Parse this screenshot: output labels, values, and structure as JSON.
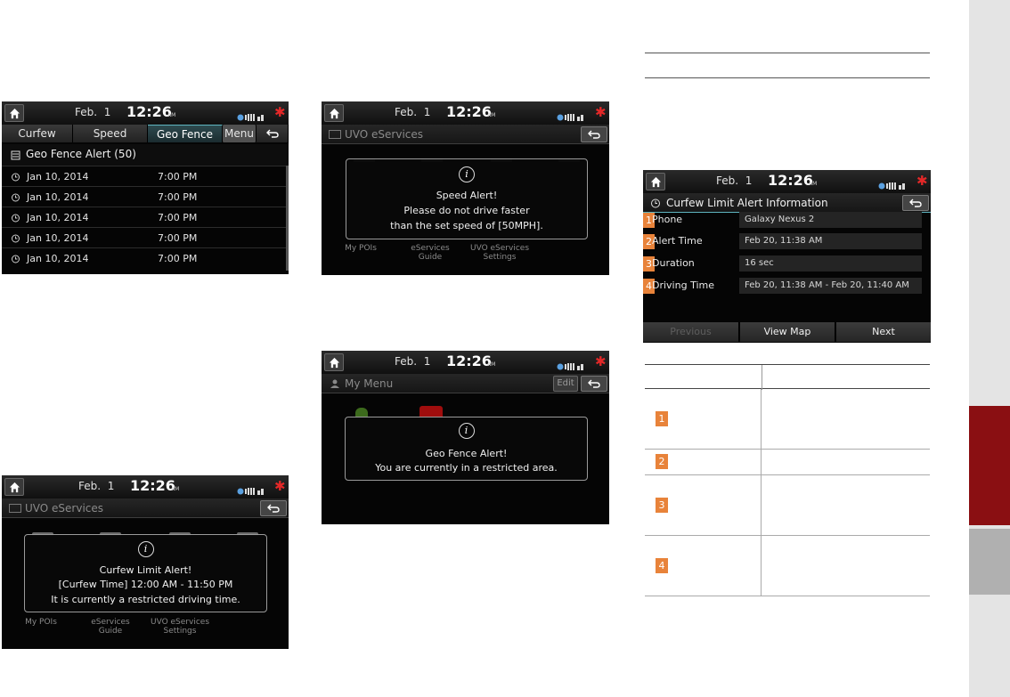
{
  "status": {
    "date": "Feb.  1",
    "time": "12:26",
    "ampm": "AM"
  },
  "screen_geofence_list": {
    "tabs": [
      "Curfew",
      "Speed",
      "Geo Fence",
      "Menu"
    ],
    "active_tab": "Geo Fence",
    "list_title": "Geo Fence Alert (50)",
    "rows": [
      {
        "date": "Jan 10, 2014",
        "time": "7:00 PM"
      },
      {
        "date": "Jan 10, 2014",
        "time": "7:00 PM"
      },
      {
        "date": "Jan 10, 2014",
        "time": "7:00 PM"
      },
      {
        "date": "Jan 10, 2014",
        "time": "7:00 PM"
      },
      {
        "date": "Jan 10, 2014",
        "time": "7:00 PM"
      }
    ]
  },
  "screen_speed_alert": {
    "title": "UVO eServices",
    "popup": {
      "heading": "Speed Alert!",
      "line1": "Please do not drive faster",
      "line2": "than the set speed of [50MPH]."
    },
    "bg_labels": [
      "My POIs",
      "eServices\nGuide",
      "UVO eServices\nSettings"
    ]
  },
  "screen_geofence_alert": {
    "title": "My Menu",
    "edit_label": "Edit",
    "popup": {
      "heading": "Geo Fence Alert!",
      "line1": "You are currently in a restricted area."
    }
  },
  "screen_curfew_alert": {
    "title": "UVO eServices",
    "popup": {
      "heading": "Curfew Limit Alert!",
      "line1": "[Curfew Time] 12:00 AM - 11:50 PM",
      "line2": "It is currently a restricted driving time."
    },
    "bg_labels": [
      "My POIs",
      "eServices\nGuide",
      "UVO eServices\nSettings"
    ]
  },
  "screen_curfew_info": {
    "title": "Curfew Limit Alert Information",
    "rows": [
      {
        "num": "1",
        "label": "Phone",
        "value": "Galaxy Nexus 2"
      },
      {
        "num": "2",
        "label": "Alert Time",
        "value": "Feb 20, 11:38 AM"
      },
      {
        "num": "3",
        "label": "Duration",
        "value": "16 sec"
      },
      {
        "num": "4",
        "label": "Driving Time",
        "value": "Feb 20, 11:38 AM - Feb 20, 11:40 AM"
      }
    ],
    "buttons": {
      "previous": "Previous",
      "view_map": "View Map",
      "next": "Next"
    }
  },
  "legend_table": {
    "badges": [
      "1",
      "2",
      "3",
      "4"
    ]
  },
  "colors": {
    "badge": "#e8833a",
    "accent_red": "#8a0f12",
    "alert_star": "#e32828"
  }
}
